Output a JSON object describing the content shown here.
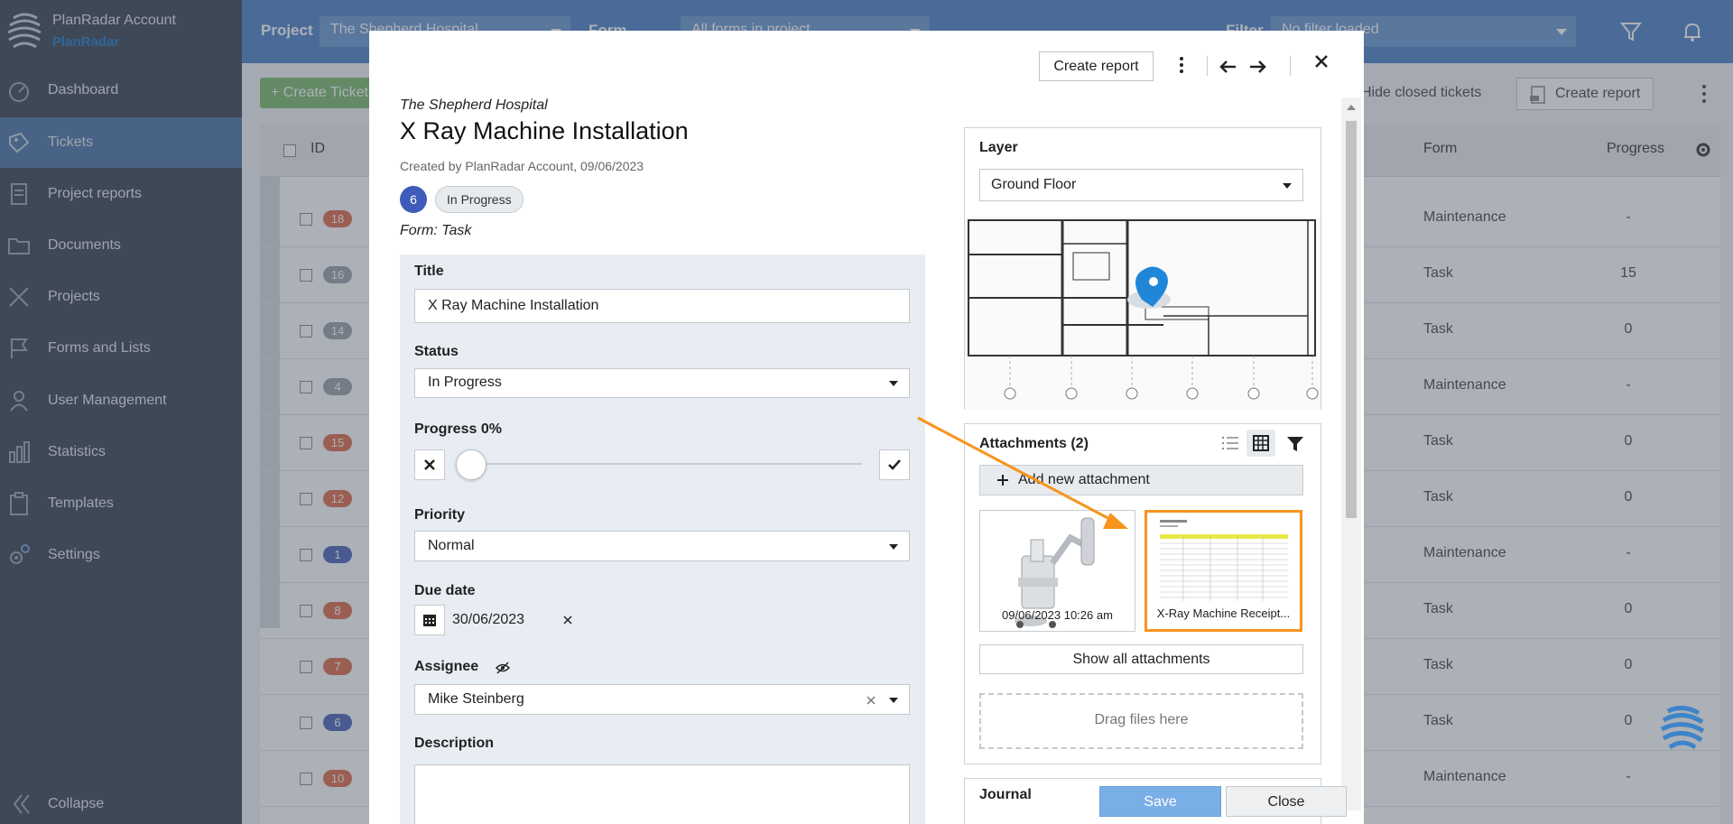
{
  "colors": {
    "accent": "#4e82c6",
    "sidebar_bg": "#394250",
    "highlight": "#f7941d",
    "badge_orange": "#e06a48",
    "badge_gray": "#9aa1a9",
    "badge_blue": "#4a63b8",
    "save": "#7aaee6"
  },
  "sidebar": {
    "account_name": "PlanRadar Account",
    "company": "PlanRadar",
    "items": [
      {
        "label": "Dashboard",
        "icon": "dashboard-icon"
      },
      {
        "label": "Tickets",
        "icon": "ticket-icon",
        "active": true
      },
      {
        "label": "Project reports",
        "icon": "report-icon"
      },
      {
        "label": "Documents",
        "icon": "folder-icon"
      },
      {
        "label": "Projects",
        "icon": "projects-icon"
      },
      {
        "label": "Forms and Lists",
        "icon": "flag-icon"
      },
      {
        "label": "User Management",
        "icon": "user-icon"
      },
      {
        "label": "Statistics",
        "icon": "bar-chart-icon"
      },
      {
        "label": "Templates",
        "icon": "clipboard-icon"
      },
      {
        "label": "Settings",
        "icon": "gear-icon"
      }
    ],
    "collapse_label": "Collapse"
  },
  "topbar": {
    "project_label": "Project",
    "project_value": "The Shepherd Hospital",
    "form_label": "Form",
    "form_value": "All forms in project",
    "filter_label": "Filter",
    "filter_value": "No filter loaded"
  },
  "background": {
    "create_ticket_label": "Create Ticket",
    "hide_closed_label": "Hide closed tickets",
    "create_report_label": "Create report",
    "columns": {
      "id": "ID",
      "form": "Form",
      "progress": "Progress"
    },
    "rows": [
      {
        "id": "18",
        "form": "Maintenance",
        "progress": "-",
        "color": "orange"
      },
      {
        "id": "16",
        "form": "Task",
        "progress": "15",
        "color": "gray"
      },
      {
        "id": "14",
        "form": "Task",
        "progress": "0",
        "color": "gray"
      },
      {
        "id": "4",
        "form": "Maintenance",
        "progress": "-",
        "color": "gray"
      },
      {
        "id": "15",
        "form": "Task",
        "progress": "0",
        "color": "orange"
      },
      {
        "id": "12",
        "form": "Task",
        "progress": "0",
        "color": "orange"
      },
      {
        "id": "1",
        "form": "Maintenance",
        "progress": "-",
        "color": "blue"
      },
      {
        "id": "8",
        "form": "Task",
        "progress": "0",
        "color": "orange"
      },
      {
        "id": "7",
        "form": "Task",
        "progress": "0",
        "color": "orange"
      },
      {
        "id": "6",
        "form": "Task",
        "progress": "0",
        "color": "blue"
      },
      {
        "id": "10",
        "form": "Maintenance",
        "progress": "-",
        "color": "orange"
      }
    ]
  },
  "modal": {
    "create_report_label": "Create report",
    "project_name": "The Shepherd Hospital",
    "ticket_title": "X Ray Machine Installation",
    "created_by": "Created by PlanRadar Account, 09/06/2023",
    "ticket_number": "6",
    "status_badge": "In Progress",
    "form_type": "Form: Task",
    "fields": {
      "title_label": "Title",
      "title_value": "X Ray Machine Installation",
      "status_label": "Status",
      "status_value": "In Progress",
      "progress_label": "Progress 0%",
      "progress_value": 0,
      "priority_label": "Priority",
      "priority_value": "Normal",
      "due_label": "Due date",
      "due_value": "30/06/2023",
      "assignee_label": "Assignee",
      "assignee_value": "Mike Steinberg",
      "description_label": "Description"
    },
    "layer": {
      "title": "Layer",
      "value": "Ground Floor"
    },
    "attachments": {
      "title": "Attachments (2)",
      "add_label": "Add new attachment",
      "items": [
        {
          "caption": "09/06/2023 10:26 am"
        },
        {
          "caption": "X-Ray Machine Receipt...",
          "highlighted": true
        }
      ],
      "show_all_label": "Show all attachments",
      "drop_label": "Drag files here"
    },
    "journal_title": "Journal",
    "save_label": "Save",
    "close_label": "Close"
  }
}
